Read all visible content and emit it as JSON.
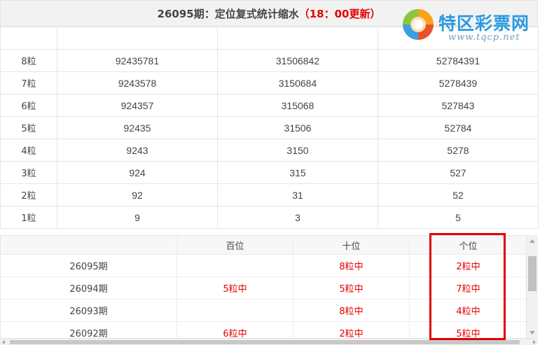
{
  "title": {
    "main": "26095期：定位复式统计缩水",
    "update": "（18：00更新）"
  },
  "logo": {
    "name": "特区彩票网",
    "url": "www.tqcp.net"
  },
  "top_table": {
    "rows": [
      {
        "label": "8粒",
        "v1": "92435781",
        "v2": "31506842",
        "v3": "52784391"
      },
      {
        "label": "7粒",
        "v1": "9243578",
        "v2": "3150684",
        "v3": "5278439"
      },
      {
        "label": "6粒",
        "v1": "924357",
        "v2": "315068",
        "v3": "527843"
      },
      {
        "label": "5粒",
        "v1": "92435",
        "v2": "31506",
        "v3": "52784"
      },
      {
        "label": "4粒",
        "v1": "9243",
        "v2": "3150",
        "v3": "5278"
      },
      {
        "label": "3粒",
        "v1": "924",
        "v2": "315",
        "v3": "527"
      },
      {
        "label": "2粒",
        "v1": "92",
        "v2": "31",
        "v3": "52"
      },
      {
        "label": "1粒",
        "v1": "9",
        "v2": "3",
        "v3": "5"
      }
    ]
  },
  "bottom_table": {
    "headers": [
      "",
      "百位",
      "十位",
      "个位"
    ],
    "rows": [
      {
        "issue": "26095期",
        "bai": "",
        "shi": "8粒中",
        "ge": "2粒中"
      },
      {
        "issue": "26094期",
        "bai": "5粒中",
        "shi": "5粒中",
        "ge": "7粒中"
      },
      {
        "issue": "26093期",
        "bai": "",
        "shi": "8粒中",
        "ge": "4粒中"
      },
      {
        "issue": "26092期",
        "bai": "6粒中",
        "shi": "2粒中",
        "ge": "5粒中"
      }
    ]
  },
  "colors": {
    "accent_red": "#e60000",
    "logo_blue": "#2a9ae0"
  }
}
